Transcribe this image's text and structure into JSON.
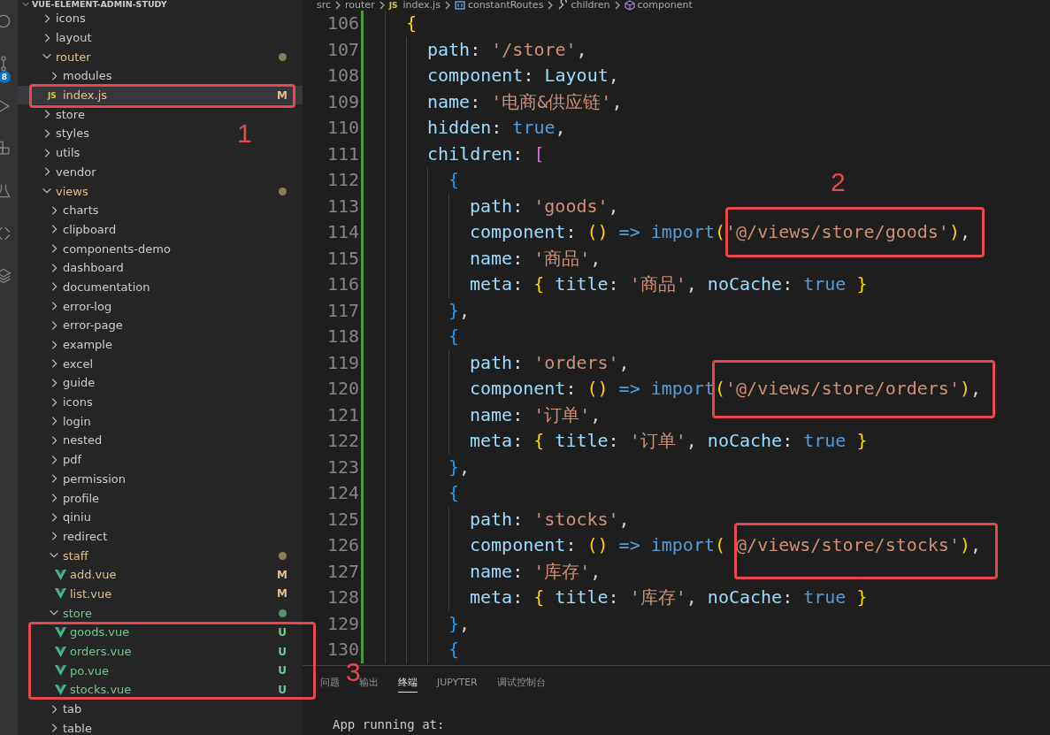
{
  "activity_bar": [
    {
      "kind": "search"
    },
    {
      "kind": "source-control",
      "badge": "8"
    },
    {
      "kind": "run"
    },
    {
      "kind": "extensions"
    },
    {
      "kind": "testing"
    },
    {
      "kind": "remote"
    },
    {
      "kind": "layers"
    }
  ],
  "explorer": {
    "root": "VUE-ELEMENT-ADMIN-STUDY",
    "expanded": true,
    "items": [
      {
        "name": "icons",
        "kind": "folder",
        "expanded": false,
        "selected": false,
        "modified": false,
        "untracked": false
      },
      {
        "name": "layout",
        "kind": "folder",
        "expanded": false,
        "selected": false,
        "modified": false,
        "untracked": false
      },
      {
        "name": "router",
        "kind": "folder",
        "expanded": true,
        "selected": false,
        "modified": true,
        "untracked": false,
        "children": [
          {
            "name": "modules",
            "kind": "folder",
            "expanded": false,
            "selected": false,
            "modified": false,
            "untracked": false
          },
          {
            "name": "index.js",
            "kind": "js",
            "icon_text": "JS",
            "modified": true,
            "untracked": false,
            "badge": "M",
            "selected": true
          }
        ]
      },
      {
        "name": "store",
        "kind": "folder",
        "expanded": false,
        "selected": false,
        "modified": false,
        "untracked": false
      },
      {
        "name": "styles",
        "kind": "folder",
        "expanded": false,
        "selected": false,
        "modified": false,
        "untracked": false
      },
      {
        "name": "utils",
        "kind": "folder",
        "expanded": false,
        "selected": false,
        "modified": false,
        "untracked": false
      },
      {
        "name": "vendor",
        "kind": "folder",
        "expanded": false,
        "selected": false,
        "modified": false,
        "untracked": false
      },
      {
        "name": "views",
        "kind": "folder",
        "expanded": true,
        "selected": false,
        "modified": true,
        "untracked": false,
        "children": [
          {
            "name": "charts",
            "kind": "folder",
            "expanded": false,
            "selected": false,
            "modified": false,
            "untracked": false
          },
          {
            "name": "clipboard",
            "kind": "folder",
            "expanded": false,
            "selected": false,
            "modified": false,
            "untracked": false
          },
          {
            "name": "components-demo",
            "kind": "folder",
            "expanded": false,
            "selected": false,
            "modified": false,
            "untracked": false
          },
          {
            "name": "dashboard",
            "kind": "folder",
            "expanded": false,
            "selected": false,
            "modified": false,
            "untracked": false
          },
          {
            "name": "documentation",
            "kind": "folder",
            "expanded": false,
            "selected": false,
            "modified": false,
            "untracked": false
          },
          {
            "name": "error-log",
            "kind": "folder",
            "expanded": false,
            "selected": false,
            "modified": false,
            "untracked": false
          },
          {
            "name": "error-page",
            "kind": "folder",
            "expanded": false,
            "selected": false,
            "modified": false,
            "untracked": false
          },
          {
            "name": "example",
            "kind": "folder",
            "expanded": false,
            "selected": false,
            "modified": false,
            "untracked": false
          },
          {
            "name": "excel",
            "kind": "folder",
            "expanded": false,
            "selected": false,
            "modified": false,
            "untracked": false
          },
          {
            "name": "guide",
            "kind": "folder",
            "expanded": false,
            "selected": false,
            "modified": false,
            "untracked": false
          },
          {
            "name": "icons",
            "kind": "folder",
            "expanded": false,
            "selected": false,
            "modified": false,
            "untracked": false
          },
          {
            "name": "login",
            "kind": "folder",
            "expanded": false,
            "selected": false,
            "modified": false,
            "untracked": false
          },
          {
            "name": "nested",
            "kind": "folder",
            "expanded": false,
            "selected": false,
            "modified": false,
            "untracked": false
          },
          {
            "name": "pdf",
            "kind": "folder",
            "expanded": false,
            "selected": false,
            "modified": false,
            "untracked": false
          },
          {
            "name": "permission",
            "kind": "folder",
            "expanded": false,
            "selected": false,
            "modified": false,
            "untracked": false
          },
          {
            "name": "profile",
            "kind": "folder",
            "expanded": false,
            "selected": false,
            "modified": false,
            "untracked": false
          },
          {
            "name": "qiniu",
            "kind": "folder",
            "expanded": false,
            "selected": false,
            "modified": false,
            "untracked": false
          },
          {
            "name": "redirect",
            "kind": "folder",
            "expanded": false,
            "selected": false,
            "modified": false,
            "untracked": false
          },
          {
            "name": "staff",
            "kind": "folder",
            "expanded": true,
            "selected": false,
            "modified": true,
            "untracked": false,
            "children": [
              {
                "name": "add.vue",
                "kind": "vue",
                "modified": true,
                "untracked": false,
                "badge": "M",
                "selected": false
              },
              {
                "name": "list.vue",
                "kind": "vue",
                "modified": true,
                "untracked": false,
                "badge": "M",
                "selected": false
              }
            ]
          },
          {
            "name": "store",
            "kind": "folder",
            "expanded": true,
            "selected": false,
            "modified": false,
            "untracked": true,
            "children": [
              {
                "name": "goods.vue",
                "kind": "vue",
                "modified": false,
                "untracked": true,
                "badge": "U",
                "selected": false
              },
              {
                "name": "orders.vue",
                "kind": "vue",
                "modified": false,
                "untracked": true,
                "badge": "U",
                "selected": false
              },
              {
                "name": "po.vue",
                "kind": "vue",
                "modified": false,
                "untracked": true,
                "badge": "U",
                "selected": false
              },
              {
                "name": "stocks.vue",
                "kind": "vue",
                "modified": false,
                "untracked": true,
                "badge": "U",
                "selected": false
              }
            ]
          },
          {
            "name": "tab",
            "kind": "folder",
            "expanded": false,
            "selected": false,
            "modified": false,
            "untracked": false
          },
          {
            "name": "table",
            "kind": "folder",
            "expanded": false,
            "selected": false,
            "modified": false,
            "untracked": false
          }
        ]
      }
    ]
  },
  "breadcrumbs": [
    {
      "text": "src",
      "kind": "folder"
    },
    {
      "text": "router",
      "kind": "folder"
    },
    {
      "text": "index.js",
      "kind": "file",
      "icon_text": "JS"
    },
    {
      "text": "constantRoutes",
      "kind": "variable"
    },
    {
      "text": "children",
      "kind": "property"
    },
    {
      "text": "component",
      "kind": "method"
    }
  ],
  "editor": {
    "lines": [
      {
        "number": "106",
        "added": true,
        "tokens": [
          {
            "text": "{",
            "kind": "open"
          }
        ]
      },
      {
        "number": "107",
        "added": true,
        "tokens": [
          {
            "text": "path",
            "kind": "prop"
          },
          {
            "text": ": ",
            "kind": "punct"
          },
          {
            "text": "'/store'",
            "kind": "str"
          },
          {
            "text": ",",
            "kind": "punct"
          }
        ]
      },
      {
        "number": "108",
        "added": true,
        "tokens": [
          {
            "text": "component",
            "kind": "prop"
          },
          {
            "text": ": ",
            "kind": "punct"
          },
          {
            "text": "Layout",
            "kind": "ident"
          },
          {
            "text": ",",
            "kind": "punct"
          }
        ]
      },
      {
        "number": "109",
        "added": true,
        "tokens": [
          {
            "text": "name",
            "kind": "prop"
          },
          {
            "text": ": ",
            "kind": "punct"
          },
          {
            "text": "'电商&供应链'",
            "kind": "str"
          },
          {
            "text": ",",
            "kind": "punct"
          }
        ]
      },
      {
        "number": "110",
        "added": true,
        "tokens": [
          {
            "text": "hidden",
            "kind": "prop"
          },
          {
            "text": ": ",
            "kind": "punct"
          },
          {
            "text": "true",
            "kind": "kw"
          },
          {
            "text": ",",
            "kind": "punct"
          }
        ]
      },
      {
        "number": "111",
        "added": true,
        "tokens": [
          {
            "text": "children",
            "kind": "prop"
          },
          {
            "text": ": ",
            "kind": "punct"
          },
          {
            "text": "[",
            "kind": "open"
          }
        ]
      },
      {
        "number": "112",
        "added": true,
        "tokens": [
          {
            "text": "{",
            "kind": "open"
          }
        ]
      },
      {
        "number": "113",
        "added": true,
        "tokens": [
          {
            "text": "path",
            "kind": "prop"
          },
          {
            "text": ": ",
            "kind": "punct"
          },
          {
            "text": "'goods'",
            "kind": "str"
          },
          {
            "text": ",",
            "kind": "punct"
          }
        ]
      },
      {
        "number": "114",
        "added": true,
        "tokens": [
          {
            "text": "component",
            "kind": "prop"
          },
          {
            "text": ": ",
            "kind": "punct"
          },
          {
            "text": "(",
            "kind": "open"
          },
          {
            "text": ")",
            "kind": "close"
          },
          {
            "text": " => ",
            "kind": "kw"
          },
          {
            "text": "import",
            "kind": "kw"
          },
          {
            "text": "(",
            "kind": "open"
          },
          {
            "text": "'@/views/store/goods'",
            "kind": "str"
          },
          {
            "text": ")",
            "kind": "close"
          },
          {
            "text": ",",
            "kind": "punct"
          }
        ]
      },
      {
        "number": "115",
        "added": true,
        "tokens": [
          {
            "text": "name",
            "kind": "prop"
          },
          {
            "text": ": ",
            "kind": "punct"
          },
          {
            "text": "'商品'",
            "kind": "str"
          },
          {
            "text": ",",
            "kind": "punct"
          }
        ]
      },
      {
        "number": "116",
        "added": true,
        "tokens": [
          {
            "text": "meta",
            "kind": "prop"
          },
          {
            "text": ": ",
            "kind": "punct"
          },
          {
            "text": "{ ",
            "kind": "open"
          },
          {
            "text": "title",
            "kind": "prop"
          },
          {
            "text": ": ",
            "kind": "punct"
          },
          {
            "text": "'商品'",
            "kind": "str"
          },
          {
            "text": ", ",
            "kind": "punct"
          },
          {
            "text": "noCache",
            "kind": "prop"
          },
          {
            "text": ": ",
            "kind": "punct"
          },
          {
            "text": "true",
            "kind": "kw"
          },
          {
            "text": " }",
            "kind": "close"
          }
        ]
      },
      {
        "number": "117",
        "added": true,
        "tokens": [
          {
            "text": "}",
            "kind": "close"
          },
          {
            "text": ",",
            "kind": "punct"
          }
        ]
      },
      {
        "number": "118",
        "added": true,
        "tokens": [
          {
            "text": "{",
            "kind": "open"
          }
        ]
      },
      {
        "number": "119",
        "added": true,
        "tokens": [
          {
            "text": "path",
            "kind": "prop"
          },
          {
            "text": ": ",
            "kind": "punct"
          },
          {
            "text": "'orders'",
            "kind": "str"
          },
          {
            "text": ",",
            "kind": "punct"
          }
        ]
      },
      {
        "number": "120",
        "added": true,
        "tokens": [
          {
            "text": "component",
            "kind": "prop"
          },
          {
            "text": ": ",
            "kind": "punct"
          },
          {
            "text": "(",
            "kind": "open"
          },
          {
            "text": ")",
            "kind": "close"
          },
          {
            "text": " => ",
            "kind": "kw"
          },
          {
            "text": "import",
            "kind": "kw"
          },
          {
            "text": "(",
            "kind": "open"
          },
          {
            "text": "'@/views/store/orders'",
            "kind": "str"
          },
          {
            "text": ")",
            "kind": "close"
          },
          {
            "text": ",",
            "kind": "punct"
          }
        ]
      },
      {
        "number": "121",
        "added": true,
        "tokens": [
          {
            "text": "name",
            "kind": "prop"
          },
          {
            "text": ": ",
            "kind": "punct"
          },
          {
            "text": "'订单'",
            "kind": "str"
          },
          {
            "text": ",",
            "kind": "punct"
          }
        ]
      },
      {
        "number": "122",
        "added": true,
        "tokens": [
          {
            "text": "meta",
            "kind": "prop"
          },
          {
            "text": ": ",
            "kind": "punct"
          },
          {
            "text": "{ ",
            "kind": "open"
          },
          {
            "text": "title",
            "kind": "prop"
          },
          {
            "text": ": ",
            "kind": "punct"
          },
          {
            "text": "'订单'",
            "kind": "str"
          },
          {
            "text": ", ",
            "kind": "punct"
          },
          {
            "text": "noCache",
            "kind": "prop"
          },
          {
            "text": ": ",
            "kind": "punct"
          },
          {
            "text": "true",
            "kind": "kw"
          },
          {
            "text": " }",
            "kind": "close"
          }
        ]
      },
      {
        "number": "123",
        "added": true,
        "tokens": [
          {
            "text": "}",
            "kind": "close"
          },
          {
            "text": ",",
            "kind": "punct"
          }
        ]
      },
      {
        "number": "124",
        "added": true,
        "tokens": [
          {
            "text": "{",
            "kind": "open"
          }
        ]
      },
      {
        "number": "125",
        "added": true,
        "tokens": [
          {
            "text": "path",
            "kind": "prop"
          },
          {
            "text": ": ",
            "kind": "punct"
          },
          {
            "text": "'stocks'",
            "kind": "str"
          },
          {
            "text": ",",
            "kind": "punct"
          }
        ]
      },
      {
        "number": "126",
        "added": true,
        "tokens": [
          {
            "text": "component",
            "kind": "prop"
          },
          {
            "text": ": ",
            "kind": "punct"
          },
          {
            "text": "(",
            "kind": "open"
          },
          {
            "text": ")",
            "kind": "close"
          },
          {
            "text": " => ",
            "kind": "kw"
          },
          {
            "text": "import",
            "kind": "kw"
          },
          {
            "text": "(",
            "kind": "open"
          },
          {
            "text": " @/views/store/stocks'",
            "kind": "str"
          },
          {
            "text": ")",
            "kind": "close"
          },
          {
            "text": ",",
            "kind": "punct"
          }
        ]
      },
      {
        "number": "127",
        "added": true,
        "tokens": [
          {
            "text": "name",
            "kind": "prop"
          },
          {
            "text": ": ",
            "kind": "punct"
          },
          {
            "text": "'库存'",
            "kind": "str"
          },
          {
            "text": ",",
            "kind": "punct"
          }
        ]
      },
      {
        "number": "128",
        "added": true,
        "tokens": [
          {
            "text": "meta",
            "kind": "prop"
          },
          {
            "text": ": ",
            "kind": "punct"
          },
          {
            "text": "{ ",
            "kind": "open"
          },
          {
            "text": "title",
            "kind": "prop"
          },
          {
            "text": ": ",
            "kind": "punct"
          },
          {
            "text": "'库存'",
            "kind": "str"
          },
          {
            "text": ", ",
            "kind": "punct"
          },
          {
            "text": "noCache",
            "kind": "prop"
          },
          {
            "text": ": ",
            "kind": "punct"
          },
          {
            "text": "true",
            "kind": "kw"
          },
          {
            "text": " }",
            "kind": "close"
          }
        ]
      },
      {
        "number": "129",
        "added": true,
        "tokens": [
          {
            "text": "}",
            "kind": "close"
          },
          {
            "text": ",",
            "kind": "punct"
          }
        ]
      },
      {
        "number": "130",
        "added": true,
        "tokens": [
          {
            "text": "{",
            "kind": "open"
          }
        ]
      }
    ]
  },
  "panel": {
    "tabs": [
      {
        "label": "问题",
        "selected": false
      },
      {
        "label": "输出",
        "selected": false
      },
      {
        "label": "终端",
        "selected": true
      },
      {
        "label": "JUPYTER",
        "selected": false
      },
      {
        "label": "调试控制台",
        "selected": false
      }
    ],
    "terminal": [
      "App running at:"
    ]
  },
  "annotations": [
    {
      "kind": "box"
    },
    {
      "kind": "box"
    },
    {
      "kind": "box"
    },
    {
      "kind": "box"
    },
    {
      "kind": "box"
    },
    {
      "kind": "number",
      "label": "1"
    },
    {
      "kind": "number",
      "label": "2"
    },
    {
      "kind": "number",
      "label": "3"
    }
  ]
}
